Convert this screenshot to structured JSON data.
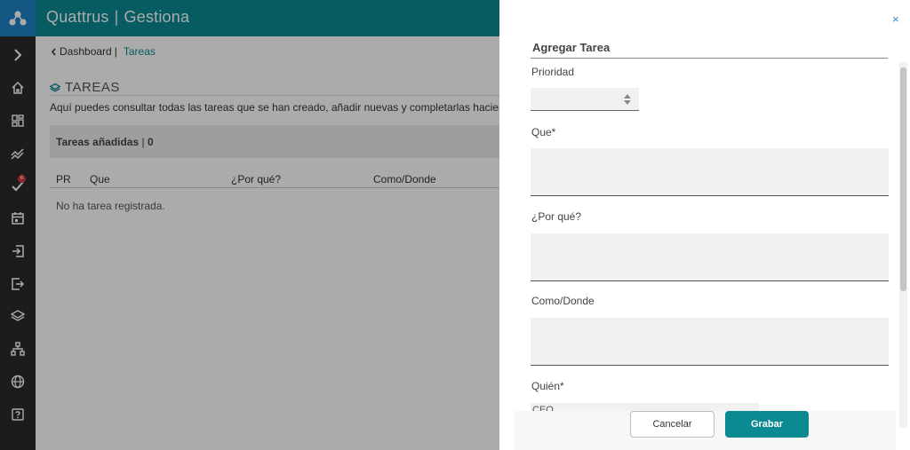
{
  "app": {
    "name": "Quattrus",
    "module": "Gestiona",
    "separator": "|"
  },
  "sidebar": {
    "items": [
      {
        "icon": "chevron-right-icon"
      },
      {
        "icon": "home-icon"
      },
      {
        "icon": "dashboard-grid-icon"
      },
      {
        "icon": "trend-icon"
      },
      {
        "icon": "tasks-check-icon",
        "badge": "6"
      },
      {
        "icon": "calendar-icon"
      },
      {
        "icon": "login-icon"
      },
      {
        "icon": "logout-icon"
      },
      {
        "icon": "layers-icon"
      },
      {
        "icon": "org-chart-icon"
      },
      {
        "icon": "globe-icon"
      },
      {
        "icon": "help-icon"
      }
    ]
  },
  "breadcrumb": {
    "parent": "Dashboard",
    "separator": "|",
    "current": "Tareas"
  },
  "page": {
    "title": "TAREAS",
    "intro": "Aquí puedes consultar todas las tareas que se han creado, añadir nuevas y completarlas haciendo clic en el",
    "count_label": "Tareas añadidas",
    "count_sep": "|",
    "count_value": "0",
    "columns": [
      "PR",
      "Que",
      "¿Por qué?",
      "Como/Donde"
    ],
    "empty_text": "No ha tarea registrada."
  },
  "panel": {
    "close": "×",
    "title": "Agregar Tarea",
    "fields": {
      "prioridad": "Prioridad",
      "que": "Que*",
      "porque": "¿Por qué?",
      "como": "Como/Donde",
      "quien": "Quién*"
    },
    "quien_value": "CEO",
    "cancel": "Cancelar",
    "save": "Grabar"
  },
  "colors": {
    "teal": "#0b8a92",
    "logo_blue": "#1d7fc4",
    "sidebar": "#2b2b2b",
    "close": "#2a87c8"
  }
}
